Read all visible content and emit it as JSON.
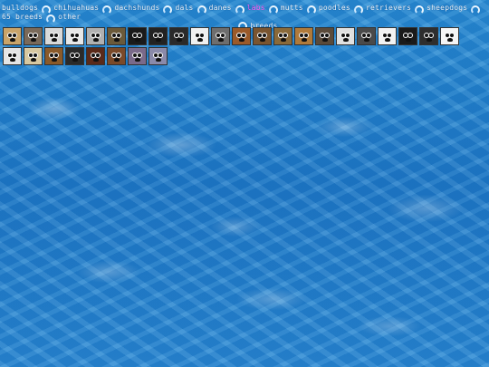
{
  "nav": {
    "items": [
      {
        "label": "bulldogs",
        "active": false
      },
      {
        "label": "chihuahuas",
        "active": false
      },
      {
        "label": "dachshunds",
        "active": false
      },
      {
        "label": "dals",
        "active": false
      },
      {
        "label": "danes",
        "active": false
      },
      {
        "label": "labs",
        "active": true
      },
      {
        "label": "mutts",
        "active": false
      },
      {
        "label": "poodles",
        "active": false
      },
      {
        "label": "retrievers",
        "active": false
      },
      {
        "label": "sheepdogs",
        "active": false
      },
      {
        "label": "65 breeds",
        "active": false
      },
      {
        "label": "other",
        "active": false
      }
    ],
    "second_line_label": "breeds"
  },
  "colors": {
    "active_link": "#ff66ff",
    "link": "#eaf6ff",
    "water": "#2a8fd6"
  },
  "tiles": [
    {
      "name": "dog-icon",
      "bg": "#c9a46a"
    },
    {
      "name": "dog-icon",
      "bg": "#7a6a5a"
    },
    {
      "name": "dog-icon",
      "bg": "#d9d9d9"
    },
    {
      "name": "dog-icon",
      "bg": "#e8e8e8"
    },
    {
      "name": "dog-icon",
      "bg": "#b0b0b0"
    },
    {
      "name": "dog-icon",
      "bg": "#6b5a3a"
    },
    {
      "name": "dog-icon",
      "bg": "#1a1a1a"
    },
    {
      "name": "dog-icon",
      "bg": "#222222"
    },
    {
      "name": "dog-icon",
      "bg": "#2a2a2a"
    },
    {
      "name": "dog-icon",
      "bg": "#f0f0f0"
    },
    {
      "name": "dog-icon",
      "bg": "#6e6e6e"
    },
    {
      "name": "dog-icon",
      "bg": "#9a5a2a"
    },
    {
      "name": "dog-icon",
      "bg": "#7a5530"
    },
    {
      "name": "dog-icon",
      "bg": "#8a6a3a"
    },
    {
      "name": "dog-icon",
      "bg": "#b07a3a"
    },
    {
      "name": "dog-icon",
      "bg": "#5a4a3a"
    },
    {
      "name": "dog-icon",
      "bg": "#e0e0e0"
    },
    {
      "name": "dog-icon",
      "bg": "#4a4a4a"
    },
    {
      "name": "dog-icon",
      "bg": "#f2f2f2"
    },
    {
      "name": "dog-icon",
      "bg": "#1a1a1a"
    },
    {
      "name": "dog-icon",
      "bg": "#2e2e2e"
    },
    {
      "name": "dog-icon",
      "bg": "#f5f5f5"
    },
    {
      "name": "dog-icon",
      "bg": "#e5e5e5"
    },
    {
      "name": "dog-icon",
      "bg": "#d8c8a0"
    },
    {
      "name": "dog-icon",
      "bg": "#8a5a2a"
    },
    {
      "name": "dog-icon",
      "bg": "#2a2a2a"
    },
    {
      "name": "dog-icon",
      "bg": "#5a2a1a"
    },
    {
      "name": "dog-icon",
      "bg": "#7a4a2a"
    },
    {
      "name": "dog-icon",
      "bg": "#7a6a8a"
    },
    {
      "name": "dog-icon",
      "bg": "#8a8aaa"
    }
  ]
}
